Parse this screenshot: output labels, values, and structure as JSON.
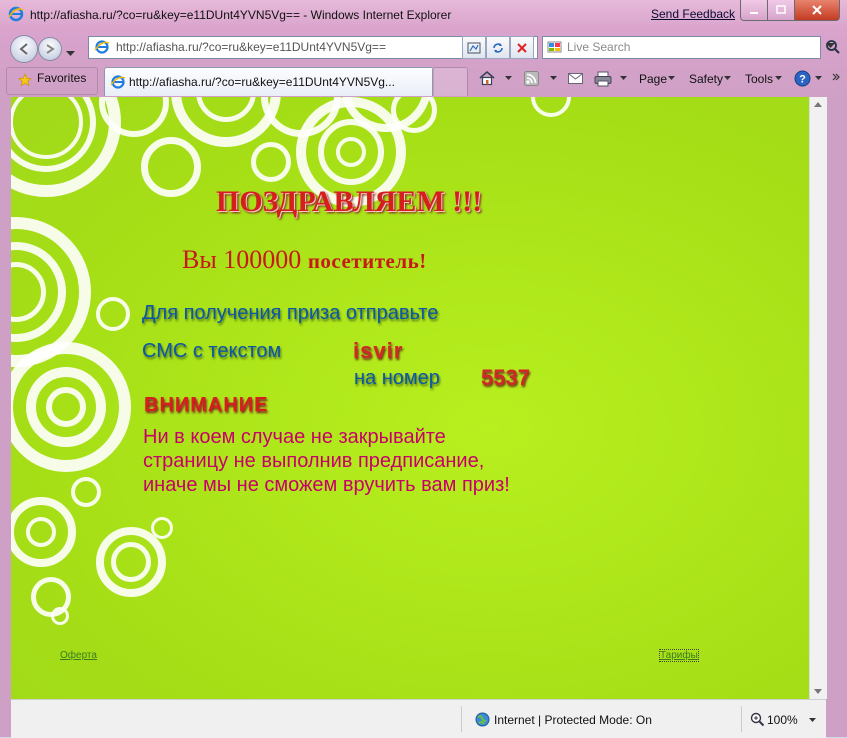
{
  "window": {
    "title": "http://afiasha.ru/?co=ru&key=e11DUnt4YVN5Vg== - Windows Internet Explorer",
    "send_feedback": "Send Feedback"
  },
  "address_bar": {
    "url": "http://afiasha.ru/?co=ru&key=e11DUnt4YVN5Vg=="
  },
  "search": {
    "placeholder": "Live Search"
  },
  "favorites": {
    "label": "Favorites"
  },
  "tab": {
    "title": "http://afiasha.ru/?co=ru&key=e11DUnt4YVN5Vg..."
  },
  "command_bar": {
    "page": "Page",
    "safety": "Safety",
    "tools": "Tools"
  },
  "content": {
    "headline": "ПОЗДРАВЛЯЕМ !!!",
    "visitor_number": "Вы 100000 ",
    "visitor_word": "посетитель!",
    "instruction_line1": "Для получения приза отправьте",
    "instruction_line2": "СМС с текстом",
    "sms_text": "isvir",
    "number_label": "на номер",
    "sms_number": "5537",
    "warning_title": "ВНИМАНИЕ",
    "warning_line1": "Ни в коем случае не закрывайте",
    "warning_line2": "страницу не выполнив предписание,",
    "warning_line3": "иначе мы не сможем вручить вам приз!",
    "footer_offer": "Оферта",
    "footer_tariffs": "Тарифы"
  },
  "status_bar": {
    "zone": "Internet | Protected Mode: On",
    "zoom": "100%"
  },
  "colors": {
    "page_bg": "#a5de16",
    "headline_red": "#d51f1f",
    "instruction_blue": "#0b57a8",
    "warning_magenta": "#c8006a"
  }
}
